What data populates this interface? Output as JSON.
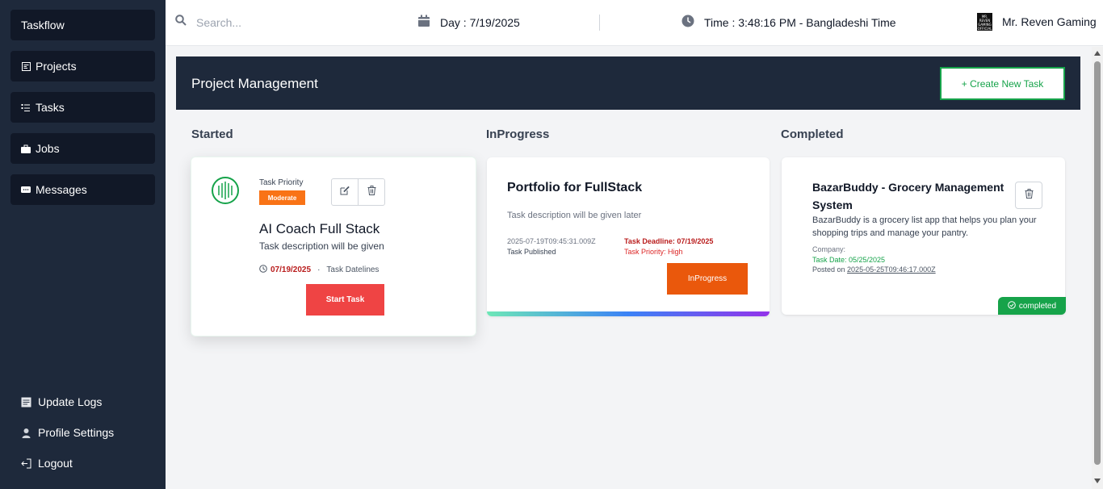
{
  "app": {
    "name": "Taskflow"
  },
  "sidebar": {
    "items": [
      {
        "label": "Projects",
        "icon": "projects-icon"
      },
      {
        "label": "Tasks",
        "icon": "tasks-icon"
      },
      {
        "label": "Jobs",
        "icon": "briefcase-icon"
      },
      {
        "label": "Messages",
        "icon": "message-icon"
      }
    ],
    "bottom": [
      {
        "label": "Update Logs",
        "icon": "logs-icon"
      },
      {
        "label": "Profile Settings",
        "icon": "user-icon"
      },
      {
        "label": "Logout",
        "icon": "logout-icon"
      }
    ]
  },
  "topbar": {
    "search_placeholder": "Search...",
    "day": "Day : 7/19/2025",
    "time": "Time : 3:48:16 PM - Bangladeshi Time",
    "user_name": "Mr. Reven Gaming",
    "avatar_text": "MR. REVEN GAMING OFFICIAL"
  },
  "main": {
    "title": "Project Management",
    "create_button": "+ Create New Task",
    "columns": [
      "Started",
      "InProgress",
      "Completed"
    ]
  },
  "cards": {
    "started": {
      "priority_label": "Task Priority",
      "priority": "Moderate",
      "title": "AI Coach Full Stack",
      "description": "Task description will be given",
      "date": "07/19/2025",
      "separator": "·",
      "date_label": "Task Datelines",
      "button": "Start Task"
    },
    "inprogress": {
      "title": "Portfolio for FullStack",
      "description": "Task description will be given later",
      "published_date": "2025-07-19T09:45:31.009Z",
      "published_label": "Task Published",
      "deadline": "Task Deadline: 07/19/2025",
      "priority": "Task Priority: High",
      "button": "InProgress"
    },
    "completed": {
      "title": "BazarBuddy - Grocery Management System",
      "description": "BazarBuddy is a grocery list app that helps you plan your shopping trips and manage your pantry.",
      "company": "Company:",
      "task_date": "Task Date: 05/25/2025",
      "posted_prefix": "Posted on",
      "posted_date": "2025-05-25T09:46:17.000Z",
      "badge": "completed"
    }
  },
  "colors": {
    "sidebar_bg": "#1e293b",
    "accent_green": "#16a34a",
    "start_red": "#ef4444",
    "inprogress_orange": "#ea580c",
    "moderate_orange": "#f97316"
  }
}
